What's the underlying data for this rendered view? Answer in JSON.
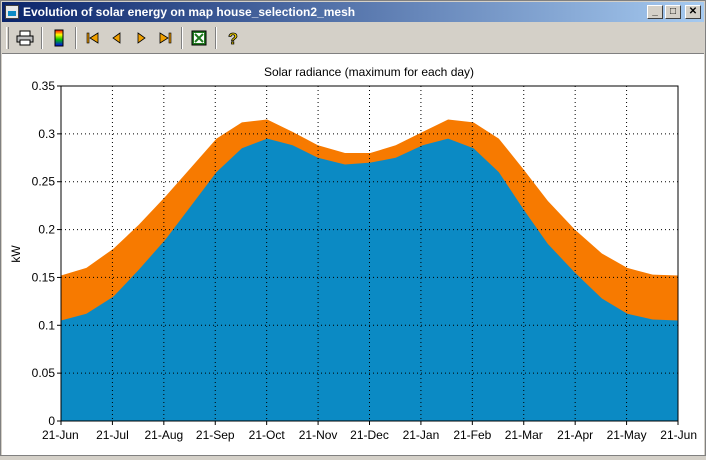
{
  "window": {
    "title": "Evolution of solar energy on map house_selection2_mesh",
    "buttons": [
      "minimize",
      "maximize",
      "close"
    ]
  },
  "toolbar": {
    "items": [
      {
        "name": "print-icon",
        "glyph": "🖶"
      },
      {
        "name": "color-palette-icon",
        "glyph": "▮"
      },
      {
        "name": "first-frame-icon",
        "glyph": "⏮"
      },
      {
        "name": "previous-frame-icon",
        "glyph": "◀"
      },
      {
        "name": "next-frame-icon",
        "glyph": "▶"
      },
      {
        "name": "last-frame-icon",
        "glyph": "⏭"
      },
      {
        "name": "export-excel-icon",
        "glyph": "X"
      },
      {
        "name": "help-icon",
        "glyph": "?"
      }
    ]
  },
  "chart_data": {
    "type": "area",
    "title": "Solar radiance (maximum for each day)",
    "xlabel": "",
    "ylabel": "kW",
    "ylim": [
      0,
      0.35
    ],
    "yticks": [
      "0",
      "0.05",
      "0.1",
      "0.15",
      "0.2",
      "0.25",
      "0.3",
      "0.35"
    ],
    "xlim": [
      0,
      365
    ],
    "xtick_labels": [
      "21-Jun",
      "21-Jul",
      "21-Aug",
      "21-Sep",
      "21-Oct",
      "21-Nov",
      "21-Dec",
      "21-Jan",
      "21-Feb",
      "21-Mar",
      "21-Apr",
      "21-May",
      "21-Jun"
    ],
    "grid": true,
    "x": [
      0,
      15,
      31,
      46,
      62,
      77,
      92,
      107,
      122,
      137,
      152,
      168,
      183,
      198,
      214,
      229,
      244,
      259,
      274,
      288,
      304,
      320,
      335,
      350,
      365
    ],
    "series": [
      {
        "color": "#0b8ac4",
        "values": [
          0.105,
          0.112,
          0.13,
          0.158,
          0.19,
          0.225,
          0.26,
          0.285,
          0.295,
          0.288,
          0.275,
          0.268,
          0.27,
          0.275,
          0.288,
          0.295,
          0.285,
          0.26,
          0.22,
          0.185,
          0.155,
          0.128,
          0.112,
          0.106,
          0.105
        ]
      },
      {
        "color": "#f77a00",
        "values": [
          0.152,
          0.16,
          0.18,
          0.205,
          0.235,
          0.265,
          0.295,
          0.312,
          0.315,
          0.302,
          0.288,
          0.28,
          0.28,
          0.288,
          0.302,
          0.315,
          0.312,
          0.295,
          0.262,
          0.23,
          0.2,
          0.175,
          0.16,
          0.153,
          0.152
        ]
      }
    ]
  }
}
